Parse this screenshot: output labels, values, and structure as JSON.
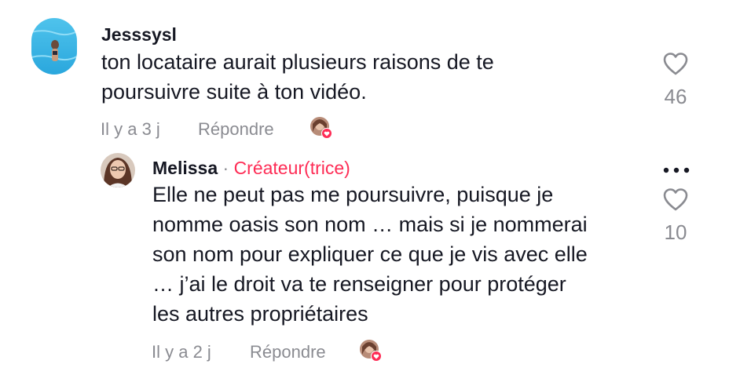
{
  "comment": {
    "username": "Jesssysl",
    "text_lines": [
      "ton locataire aurait plusieurs raisons de te",
      "poursuivre suite à ton vidéo."
    ],
    "timestamp": "Il y a 3 j",
    "reply_label": "Répondre",
    "like_count": "46",
    "like_icon": "heart-outline-icon"
  },
  "reply": {
    "username": "Melissa",
    "separator": "·",
    "creator_label": "Créateur(trice)",
    "text_lines": [
      "Elle ne peut pas me poursuivre, puisque je",
      "nomme oasis son nom … mais si je nommerai",
      "son nom pour expliquer ce que je vis avec elle",
      "… j’ai le droit va te renseigner pour protéger",
      "les autres propriétaires"
    ],
    "timestamp": "Il y a 2 j",
    "reply_label": "Répondre",
    "like_count": "10",
    "like_icon": "heart-outline-icon",
    "more_icon": "more-dots-icon"
  },
  "colors": {
    "accent": "#fe2c55",
    "muted": "#8a8b91",
    "text": "#161823"
  }
}
